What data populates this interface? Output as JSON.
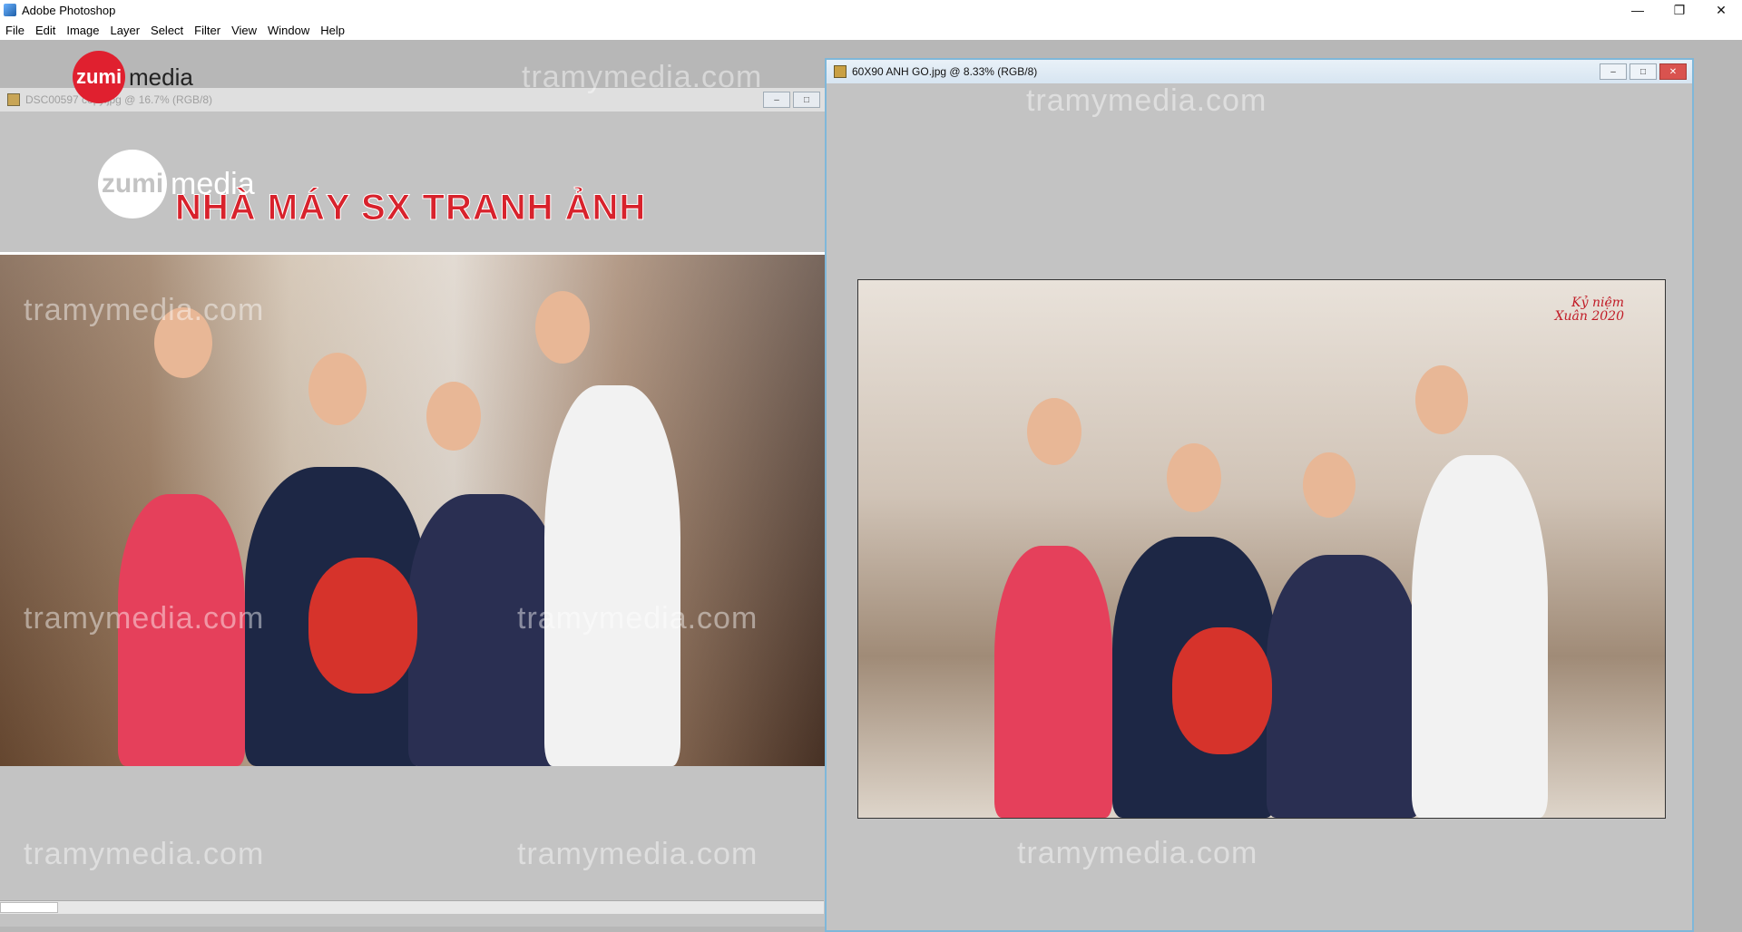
{
  "app": {
    "title": "Adobe Photoshop"
  },
  "window_controls": {
    "minimize": "—",
    "restore": "❐",
    "close": "✕"
  },
  "menu": [
    "File",
    "Edit",
    "Image",
    "Layer",
    "Select",
    "Filter",
    "View",
    "Window",
    "Help"
  ],
  "documents": {
    "left": {
      "title": "DSC00597 copy.jpg @ 16.7% (RGB/8)",
      "brand_small": {
        "circle": "zumi",
        "word": "media"
      },
      "brand_main": {
        "circle": "zumi",
        "word": "media"
      },
      "headline": "NHÀ MÁY SX TRANH ẢNH"
    },
    "right": {
      "title": "60X90 ANH GO.jpg @ 8.33% (RGB/8)",
      "stamp_line1": "Kỷ niệm",
      "stamp_line2": "Xuân 2020"
    }
  },
  "watermark": "tramymedia.com"
}
